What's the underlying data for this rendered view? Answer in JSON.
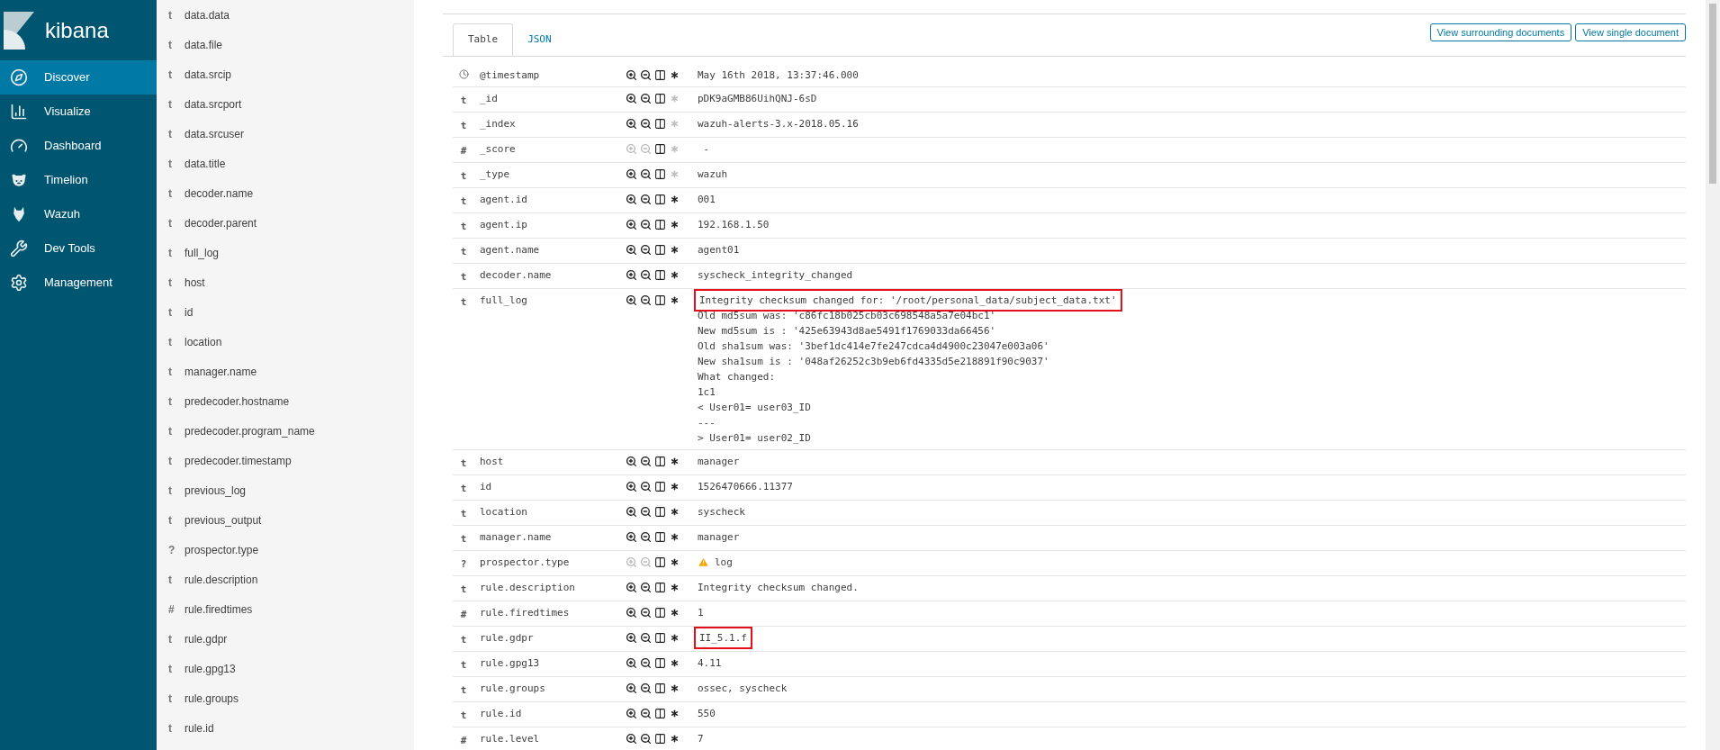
{
  "brand": {
    "name": "kibana"
  },
  "nav": [
    {
      "label": "Discover",
      "selected": true
    },
    {
      "label": "Visualize",
      "selected": false
    },
    {
      "label": "Dashboard",
      "selected": false
    },
    {
      "label": "Timelion",
      "selected": false
    },
    {
      "label": "Wazuh",
      "selected": false
    },
    {
      "label": "Dev Tools",
      "selected": false
    },
    {
      "label": "Management",
      "selected": false
    }
  ],
  "fields": [
    {
      "symbol": "t",
      "name": "data.data"
    },
    {
      "symbol": "t",
      "name": "data.file"
    },
    {
      "symbol": "t",
      "name": "data.srcip"
    },
    {
      "symbol": "t",
      "name": "data.srcport"
    },
    {
      "symbol": "t",
      "name": "data.srcuser"
    },
    {
      "symbol": "t",
      "name": "data.title"
    },
    {
      "symbol": "t",
      "name": "decoder.name"
    },
    {
      "symbol": "t",
      "name": "decoder.parent"
    },
    {
      "symbol": "t",
      "name": "full_log"
    },
    {
      "symbol": "t",
      "name": "host"
    },
    {
      "symbol": "t",
      "name": "id"
    },
    {
      "symbol": "t",
      "name": "location"
    },
    {
      "symbol": "t",
      "name": "manager.name"
    },
    {
      "symbol": "t",
      "name": "predecoder.hostname"
    },
    {
      "symbol": "t",
      "name": "predecoder.program_name"
    },
    {
      "symbol": "t",
      "name": "predecoder.timestamp"
    },
    {
      "symbol": "t",
      "name": "previous_log"
    },
    {
      "symbol": "t",
      "name": "previous_output"
    },
    {
      "symbol": "?",
      "name": "prospector.type"
    },
    {
      "symbol": "t",
      "name": "rule.description"
    },
    {
      "symbol": "#",
      "name": "rule.firedtimes"
    },
    {
      "symbol": "t",
      "name": "rule.gdpr"
    },
    {
      "symbol": "t",
      "name": "rule.gpg13"
    },
    {
      "symbol": "t",
      "name": "rule.groups"
    },
    {
      "symbol": "t",
      "name": "rule.id"
    }
  ],
  "tabs": [
    {
      "label": "Table",
      "selected": true
    },
    {
      "label": "JSON",
      "selected": false
    }
  ],
  "actions": [
    "View surrounding documents",
    "View single document"
  ],
  "rows": [
    {
      "kind": "date",
      "field": "@timestamp",
      "filterable": true,
      "exists_filter": true,
      "warning": false,
      "lines": [
        {
          "text": "May 16th 2018, 13:37:46.000",
          "highlighted": false
        }
      ]
    },
    {
      "kind": "typed",
      "symbol": "t",
      "field": "_id",
      "filterable": true,
      "exists_filter": false,
      "warning": false,
      "lines": [
        {
          "text": "pDK9aGMB86UihQNJ-6sD",
          "highlighted": false
        }
      ]
    },
    {
      "kind": "typed",
      "symbol": "t",
      "field": "_index",
      "filterable": true,
      "exists_filter": false,
      "warning": false,
      "lines": [
        {
          "text": "wazuh-alerts-3.x-2018.05.16",
          "highlighted": false
        }
      ]
    },
    {
      "kind": "typed",
      "symbol": "#",
      "field": "_score",
      "filterable": false,
      "exists_filter": false,
      "warning": false,
      "lines": [
        {
          "text": " -",
          "highlighted": false
        }
      ]
    },
    {
      "kind": "typed",
      "symbol": "t",
      "field": "_type",
      "filterable": true,
      "exists_filter": false,
      "warning": false,
      "lines": [
        {
          "text": "wazuh",
          "highlighted": false
        }
      ]
    },
    {
      "kind": "typed",
      "symbol": "t",
      "field": "agent.id",
      "filterable": true,
      "exists_filter": true,
      "warning": false,
      "lines": [
        {
          "text": "001",
          "highlighted": false
        }
      ]
    },
    {
      "kind": "typed",
      "symbol": "t",
      "field": "agent.ip",
      "filterable": true,
      "exists_filter": true,
      "warning": false,
      "lines": [
        {
          "text": "192.168.1.50",
          "highlighted": false
        }
      ]
    },
    {
      "kind": "typed",
      "symbol": "t",
      "field": "agent.name",
      "filterable": true,
      "exists_filter": true,
      "warning": false,
      "lines": [
        {
          "text": "agent01",
          "highlighted": false
        }
      ]
    },
    {
      "kind": "typed",
      "symbol": "t",
      "field": "decoder.name",
      "filterable": true,
      "exists_filter": true,
      "warning": false,
      "lines": [
        {
          "text": "syscheck_integrity_changed",
          "highlighted": false
        }
      ]
    },
    {
      "kind": "typed",
      "symbol": "t",
      "field": "full_log",
      "filterable": true,
      "exists_filter": true,
      "warning": false,
      "lines": [
        {
          "text": "Integrity checksum changed for: '/root/personal_data/subject_data.txt'",
          "highlighted": true
        },
        {
          "text": "Old md5sum was: 'c86fc18b025cb03c698548a5a7e04bc1'",
          "highlighted": false
        },
        {
          "text": "New md5sum is : '425e63943d8ae5491f1769033da66456'",
          "highlighted": false
        },
        {
          "text": "Old sha1sum was: '3bef1dc414e7fe247cdca4d4900c23047e003a06'",
          "highlighted": false
        },
        {
          "text": "New sha1sum is : '048af26252c3b9eb6fd4335d5e218891f90c9037'",
          "highlighted": false
        },
        {
          "text": "What changed:",
          "highlighted": false
        },
        {
          "text": "1c1",
          "highlighted": false
        },
        {
          "text": "< User01= user03_ID",
          "highlighted": false
        },
        {
          "text": "---",
          "highlighted": false
        },
        {
          "text": "> User01= user02_ID",
          "highlighted": false
        }
      ]
    },
    {
      "kind": "typed",
      "symbol": "t",
      "field": "host",
      "filterable": true,
      "exists_filter": true,
      "warning": false,
      "lines": [
        {
          "text": "manager",
          "highlighted": false
        }
      ]
    },
    {
      "kind": "typed",
      "symbol": "t",
      "field": "id",
      "filterable": true,
      "exists_filter": true,
      "warning": false,
      "lines": [
        {
          "text": "1526470666.11377",
          "highlighted": false
        }
      ]
    },
    {
      "kind": "typed",
      "symbol": "t",
      "field": "location",
      "filterable": true,
      "exists_filter": true,
      "warning": false,
      "lines": [
        {
          "text": "syscheck",
          "highlighted": false
        }
      ]
    },
    {
      "kind": "typed",
      "symbol": "t",
      "field": "manager.name",
      "filterable": true,
      "exists_filter": true,
      "warning": false,
      "lines": [
        {
          "text": "manager",
          "highlighted": false
        }
      ]
    },
    {
      "kind": "typed",
      "symbol": "?",
      "field": "prospector.type",
      "filterable": false,
      "exists_filter": true,
      "warning": true,
      "lines": [
        {
          "text": "log",
          "highlighted": false
        }
      ]
    },
    {
      "kind": "typed",
      "symbol": "t",
      "field": "rule.description",
      "filterable": true,
      "exists_filter": true,
      "warning": false,
      "lines": [
        {
          "text": "Integrity checksum changed.",
          "highlighted": false
        }
      ]
    },
    {
      "kind": "typed",
      "symbol": "#",
      "field": "rule.firedtimes",
      "filterable": true,
      "exists_filter": true,
      "warning": false,
      "lines": [
        {
          "text": "1",
          "highlighted": false
        }
      ]
    },
    {
      "kind": "typed",
      "symbol": "t",
      "field": "rule.gdpr",
      "filterable": true,
      "exists_filter": true,
      "warning": false,
      "lines": [
        {
          "text": "II_5.1.f",
          "highlighted": true
        }
      ]
    },
    {
      "kind": "typed",
      "symbol": "t",
      "field": "rule.gpg13",
      "filterable": true,
      "exists_filter": true,
      "warning": false,
      "lines": [
        {
          "text": "4.11",
          "highlighted": false
        }
      ]
    },
    {
      "kind": "typed",
      "symbol": "t",
      "field": "rule.groups",
      "filterable": true,
      "exists_filter": true,
      "warning": false,
      "lines": [
        {
          "text": "ossec, syscheck",
          "highlighted": false
        }
      ]
    },
    {
      "kind": "typed",
      "symbol": "t",
      "field": "rule.id",
      "filterable": true,
      "exists_filter": true,
      "warning": false,
      "lines": [
        {
          "text": "550",
          "highlighted": false
        }
      ]
    },
    {
      "kind": "typed",
      "symbol": "#",
      "field": "rule.level",
      "filterable": true,
      "exists_filter": true,
      "warning": false,
      "lines": [
        {
          "text": "7",
          "highlighted": false
        }
      ]
    }
  ]
}
